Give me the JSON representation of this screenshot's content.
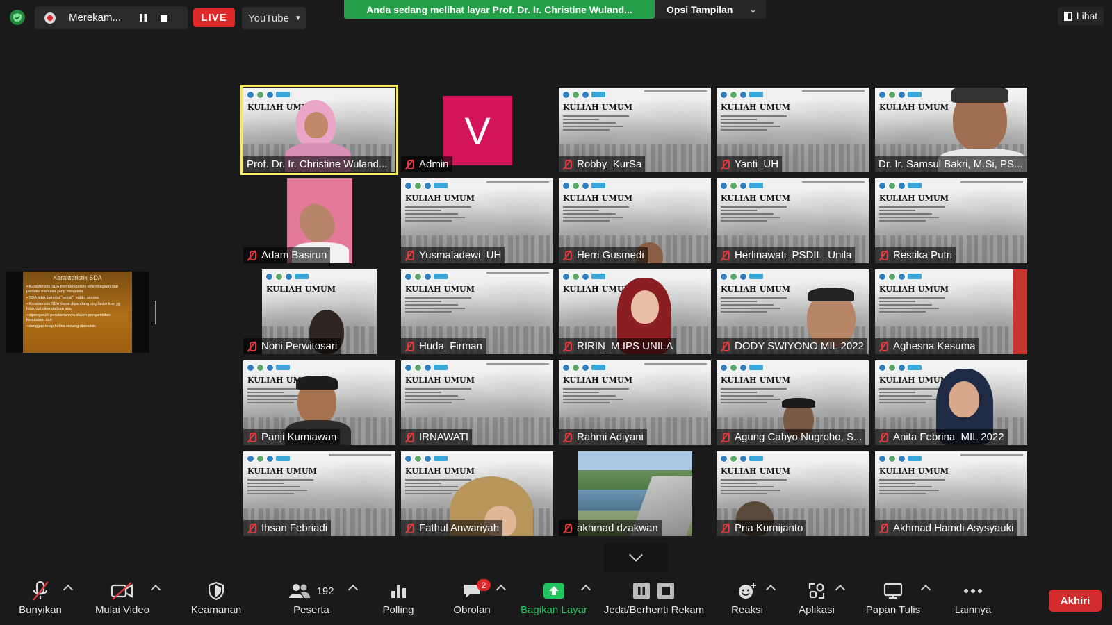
{
  "topbar": {
    "recording_label": "Merekam...",
    "live_label": "LIVE",
    "stream_target": "YouTube",
    "share_banner": "Anda sedang melihat layar Prof. Dr. Ir. Christine Wuland...",
    "view_options": "Opsi Tampilan",
    "view_button": "Lihat"
  },
  "shared_slide": {
    "title": "Karakteristik SDA",
    "bullets": [
      "Karakteristik SDA mempengaruhi kelembagaan dan perilaku manusia yang menjelola",
      "SDA tidak bersifat \"netral\", public access",
      "Karakteristik SDA dapat dipandang sbg faktor luar yg tidak dpt dikendalikan atau",
      "dipengaruhi perubahannya dalam pengambilan keputusan dan",
      "danggap tetap ketika sedang dianalisis"
    ]
  },
  "slide_text": {
    "title": "KULIAH UMUM"
  },
  "participants": [
    "Prof. Dr. Ir. Christine Wuland...",
    "Admin",
    "Robby_KurSa",
    "Yanti_UH",
    "Dr. Ir. Samsul Bakri, M.Si,  PS...",
    "Adam Basirun",
    "Yusmaladewi_UH",
    "Herri Gusmedi",
    "Herlinawati_PSDIL_Unila",
    "Restika Putri",
    "Noni Perwitosari",
    "Huda_Firman",
    "RIRIN_M.IPS UNILA",
    "DODY SWIYONO MIL 2022",
    "Aghesna Kesuma",
    "Panji Kurniawan",
    "IRNAWATI",
    "Rahmi Adiyani",
    "Agung Cahyo Nugroho, S...",
    "Anita Febrina_MIL 2022",
    "Ihsan Febriadi",
    "Fathul Anwariyah",
    "akhmad dzakwan",
    "Pria Kurnijanto",
    "Akhmad Hamdi Asysyauki"
  ],
  "admin_avatar_letter": "V",
  "toolbar": {
    "unmute": "Bunyikan",
    "start_video": "Mulai Video",
    "security": "Keamanan",
    "participants": "Peserta",
    "participants_count": "192",
    "polling": "Polling",
    "chat": "Obrolan",
    "chat_badge": "2",
    "share_screen": "Bagikan Layar",
    "pause_record": "Jeda/Berhenti Rekam",
    "reactions": "Reaksi",
    "apps": "Aplikasi",
    "whiteboard": "Papan Tulis",
    "more": "Lainnya",
    "end": "Akhiri"
  },
  "colors": {
    "share_banner": "#24a148",
    "live": "#e02828",
    "active_speaker_border": "#f5ea5a",
    "admin_avatar": "#d4145a",
    "mute_icon": "#e0393e",
    "end_button": "#d22c2c",
    "share_screen_label": "#22c45e"
  }
}
